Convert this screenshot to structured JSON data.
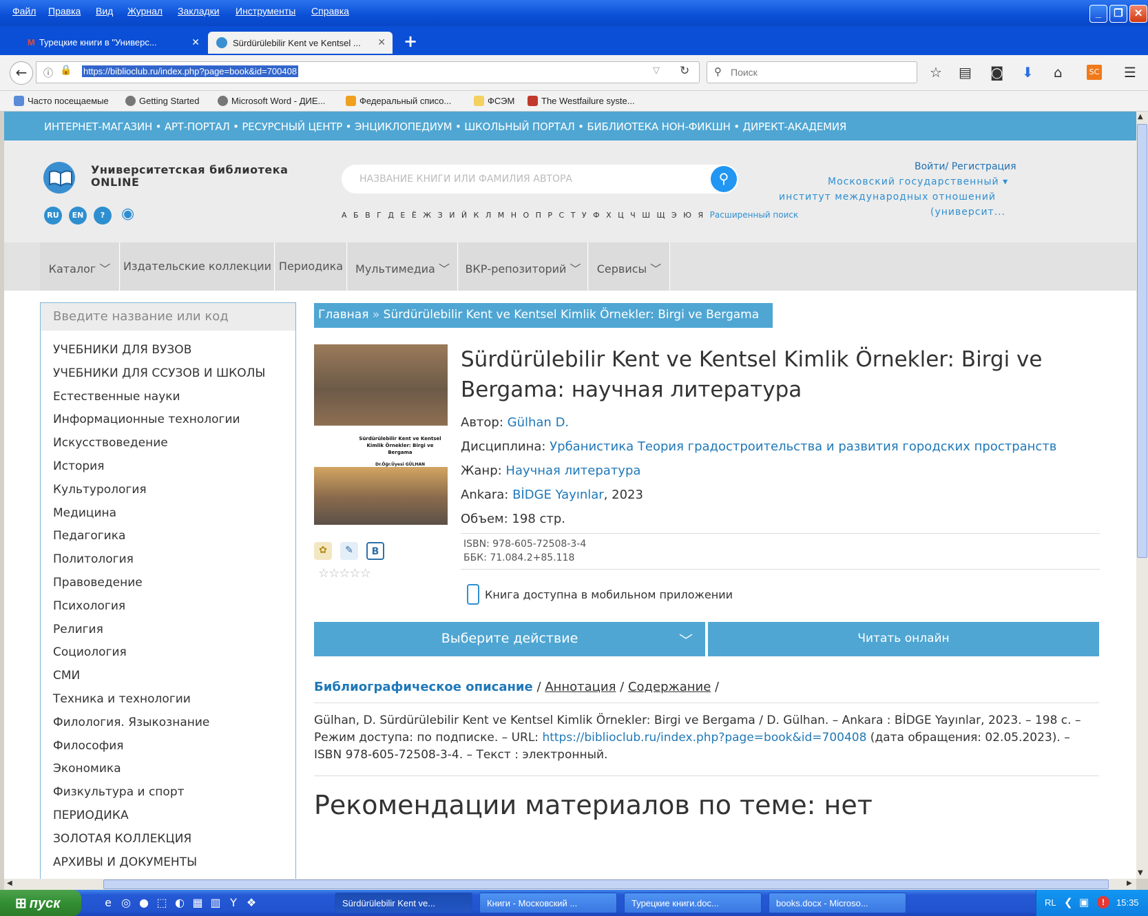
{
  "menu": [
    "Файл",
    "Правка",
    "Вид",
    "Журнал",
    "Закладки",
    "Инструменты",
    "Справка"
  ],
  "tabs": [
    {
      "label": "Турецкие книги в \"Универс...",
      "icon": "gmail-icon"
    },
    {
      "label": "Sürdürülebilir Kent ve Kentsel ...",
      "icon": "library-icon"
    }
  ],
  "new_tab": "+",
  "url": "https://biblioclub.ru/index.php?page=book&id=700408",
  "browser_search_placeholder": "Поиск",
  "bookmarks": [
    "Часто посещаемые",
    "Getting Started",
    "Microsoft Word - ДИЕ...",
    "Федеральный списо...",
    "ФСЭМ",
    "The Westfailure syste..."
  ],
  "site": {
    "topstrip": "ИНТЕРНЕТ-МАГАЗИН • АРТ-ПОРТАЛ • РЕСУРСНЫЙ ЦЕНТР • ЭНЦИКЛОПЕДИУМ • ШКОЛЬНЫЙ ПОРТАЛ • БИБЛИОТЕКА НОН-ФИКШН • ДИРЕКТ-АКАДЕМИЯ",
    "logo_line1": "Университетская библиотека",
    "logo_line2": "ONLINE",
    "langs": [
      "RU",
      "EN",
      "?"
    ],
    "search_placeholder": "НАЗВАНИЕ КНИГИ ИЛИ ФАМИЛИЯ АВТОРА",
    "alphabet": "А Б В Г Д Е Ё Ж З И Й К Л М Н О П Р С Т У Ф Х Ц Ч Ш Щ Э Ю Я",
    "advanced_search": "Расширенный поиск",
    "login": "Войти/ Регистрация",
    "org_line1": "Московский государственный ▾",
    "org_line2": "институт международных отношений",
    "org_line3": "(университ...",
    "nav": [
      "Каталог",
      "Издательские коллекции",
      "Периодика",
      "Мультимедиа",
      "ВКР-репозиторий",
      "Сервисы"
    ]
  },
  "sidebar": {
    "placeholder": "Введите название или код",
    "items": [
      "УЧЕБНИКИ ДЛЯ ВУЗОВ",
      "УЧЕБНИКИ ДЛЯ ССУЗОВ И ШКОЛЫ",
      "Естественные науки",
      "Информационные технологии",
      "Искусствоведение",
      "История",
      "Культурология",
      "Медицина",
      "Педагогика",
      "Политология",
      "Правоведение",
      "Психология",
      "Религия",
      "Социология",
      "СМИ",
      "Техника и технологии",
      "Филология. Языкознание",
      "Философия",
      "Экономика",
      "Физкультура и спорт",
      "ПЕРИОДИКА",
      "ЗОЛОТАЯ КОЛЛЕКЦИЯ",
      "АРХИВЫ И ДОКУМЕНТЫ"
    ]
  },
  "breadcrumb": {
    "home": "Главная",
    "sep": " » ",
    "current": "Sürdürülebilir Kent ve Kentsel Kimlik Örnekler: Birgi ve Bergama"
  },
  "book": {
    "cover_text_1": "Sürdürülebilir Kent ve Kentsel",
    "cover_text_2": "Kimlik Örnekler: Birgi ve Bergama",
    "cover_text_3": "Dr.Öğr.Üyesi GÜLHAN",
    "title": "Sürdürülebilir Kent ve Kentsel Kimlik Örnekler: Birgi ve Bergama: научная литература",
    "author_label": "Автор: ",
    "author": "Gülhan D.",
    "discipline_label": "Дисциплина: ",
    "discipline": "Урбанистика Теория градостроительства и развития городских пространств",
    "genre_label": "Жанр: ",
    "genre": "Научная литература",
    "city": "Ankara: ",
    "publisher": "BİDGE Yayınlar",
    "year": ", 2023",
    "volume": "Объем: 198 стр.",
    "isbn": "ISBN: 978-605-72508-3-4",
    "bbk": "ББК: 71.084.2+85.118",
    "mobile": "Книга доступна в мобильном приложении",
    "action": "Выберите действие",
    "read": "Читать онлайн",
    "stars": "☆☆☆☆☆"
  },
  "info_tabs": {
    "biblio": "Библиографическое описание",
    "sep1": " / ",
    "annot": "Аннотация",
    "sep2": " / ",
    "contents": "Содержание",
    "sep3": " /"
  },
  "biblio_text_1": "Gülhan, D. Sürdürülebilir Kent ve Kentsel Kimlik Örnekler: Birgi ve Bergama / D. Gülhan. – Ankara : BİDGE Yayınlar, 2023. – 198 с. – Режим доступа: по подписке. – URL: ",
  "biblio_link": "https://biblioclub.ru/index.php?page=book&id=700408",
  "biblio_text_2": " (дата обращения: 02.05.2023). – ISBN 978-605-72508-3-4. – Текст : электронный.",
  "recommend": "Рекомендации материалов по теме: нет",
  "taskbar": {
    "start": "пуск",
    "items": [
      "Sürdürülebilir Kent ve...",
      "Книги - Московский ...",
      "Турецкие книги.doc...",
      "books.docx - Microso..."
    ],
    "lang": "RL",
    "time": "15:35"
  },
  "colors": {
    "accent": "#4fa6d3",
    "link": "#1f78b8",
    "xp_blue": "#0a4fd6"
  }
}
